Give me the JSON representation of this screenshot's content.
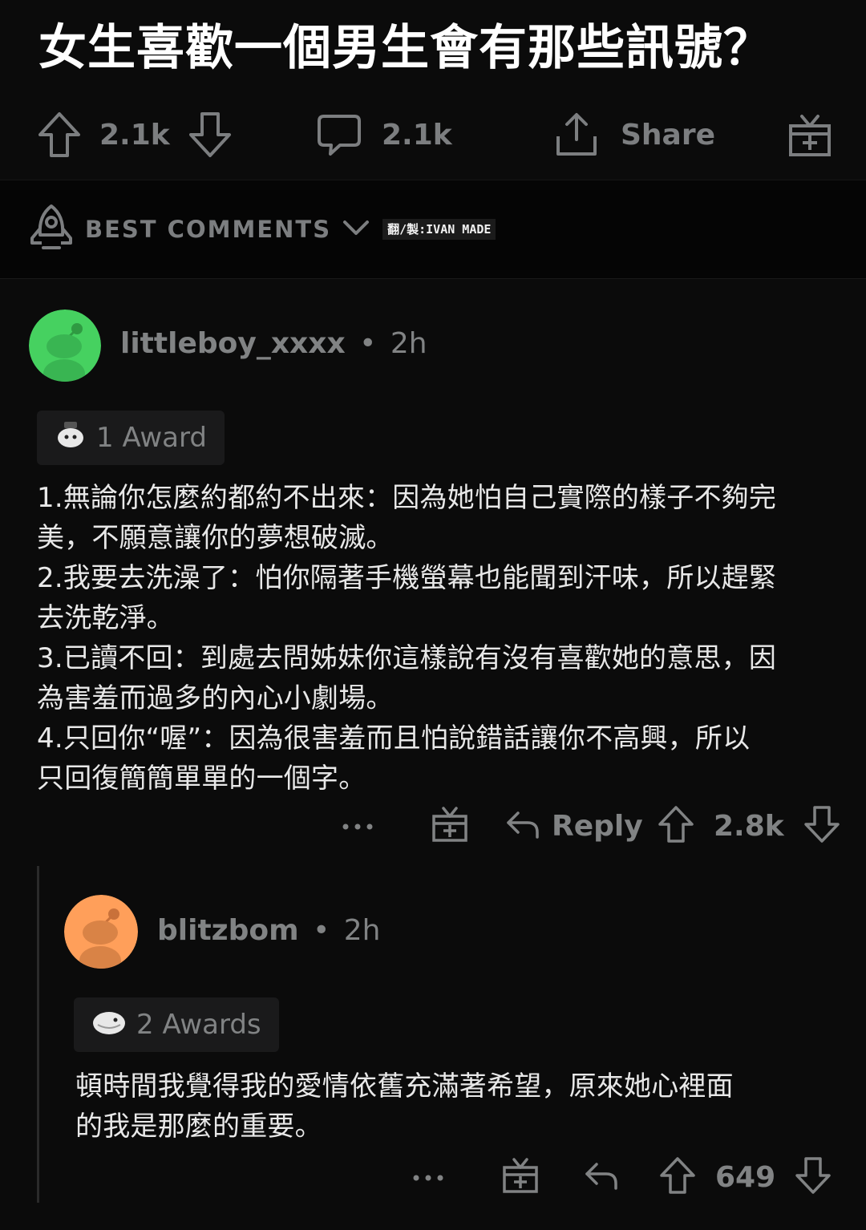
{
  "post": {
    "title": "女生喜歡一個男生會有那些訊號？",
    "upvotes": "2.1k",
    "comments": "2.1k",
    "share_label": "Share"
  },
  "sort": {
    "label": "BEST COMMENTS",
    "watermark": "翻/製:IVAN MADE"
  },
  "comments": [
    {
      "username": "littleboy_xxxx",
      "separator": "•",
      "time": "2h",
      "avatar_color": "#46d160",
      "award_label": "1 Award",
      "body": [
        "1.無論你怎麼約都約不出來：因為她怕自己實際的樣子不夠完",
        "美，不願意讓你的夢想破滅。",
        "2.我要去洗澡了：怕你隔著手機螢幕也能聞到汗味，所以趕緊",
        "去洗乾淨。",
        "3.已讀不回：到處去問姊妹你這樣說有沒有喜歡她的意思，因",
        "為害羞而過多的內心小劇場。",
        "4.只回你“喔”：因為很害羞而且怕說錯話讓你不高興，所以",
        "只回復簡簡單單的一個字。"
      ],
      "reply_label": "Reply",
      "score": "2.8k"
    },
    {
      "username": "blitzbom",
      "separator": "•",
      "time": "2h",
      "avatar_color": "#ff9f5a",
      "award_label": "2 Awards",
      "body": [
        "頓時間我覺得我的愛情依舊充滿著希望，原來她心裡面",
        "的我是那麼的重要。"
      ],
      "score": "649"
    }
  ],
  "icons": {
    "upvote": "arrow-up-icon",
    "downvote": "arrow-down-icon",
    "comment": "speech-bubble-icon",
    "share": "share-icon",
    "gift": "gift-icon",
    "sort": "rocket-icon",
    "reply": "reply-arrow-icon",
    "more": "ellipsis-icon"
  },
  "colors": {
    "background": "#0b0b0b",
    "muted_text": "#818384",
    "title_text": "#ffffff"
  }
}
